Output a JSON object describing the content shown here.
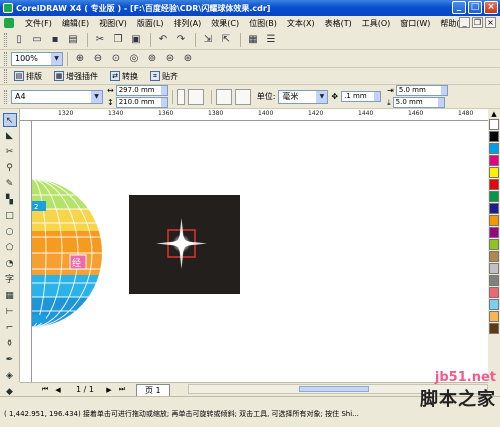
{
  "window": {
    "title": "CorelDRAW X4 ( 专业版 ) - [F:\\百度经验\\CDR\\闪耀球体效果.cdr]",
    "controls": {
      "minimize": "_",
      "maximize": "□",
      "close": "×"
    }
  },
  "menu": [
    "文件(F)",
    "编辑(E)",
    "视图(V)",
    "版面(L)",
    "排列(A)",
    "效果(C)",
    "位图(B)",
    "文本(X)",
    "表格(T)",
    "工具(O)",
    "窗口(W)",
    "帮助(H)"
  ],
  "mdi_controls": {
    "minimize": "_",
    "restore": "❐",
    "close": "×"
  },
  "toolbar2": {
    "zoom_value": "100%"
  },
  "toolbar3": {
    "items": [
      "排版",
      "增强插件",
      "转换",
      "贴齐"
    ]
  },
  "property_bar": {
    "paper": "A4",
    "width": "297.0 mm",
    "height": "210.0 mm",
    "unit_label": "单位:",
    "unit_value": "毫米",
    "nudge": ".1 mm",
    "dup_x": "5.0 mm",
    "dup_y": "5.0 mm"
  },
  "ruler": {
    "labels": [
      "1320",
      "1340",
      "1360",
      "1380",
      "1400",
      "1420",
      "1440",
      "1460",
      "1480"
    ]
  },
  "canvas": {
    "label_badges": [
      "2",
      "经"
    ]
  },
  "palette_colors": [
    "#ffffff",
    "#000000",
    "#00a0e9",
    "#e4007f",
    "#fff100",
    "#e60012",
    "#009944",
    "#1d2088",
    "#f39800",
    "#920783",
    "#8fc31f",
    "#b28850",
    "#c0c0c0",
    "#808080",
    "#eb6877",
    "#7ecef4",
    "#f8b551",
    "#603813"
  ],
  "page_nav": {
    "first": "⏮",
    "prev": "◀",
    "count": "1 / 1",
    "next": "▶",
    "last": "⏭",
    "tab": "页 1"
  },
  "status": {
    "text": "( 1,442.951, 196.434) 接着单击可进行拖动或缩放; 再单击可旋转或倾斜; 双击工具, 可选择所有对象; 按住 Shi..."
  },
  "watermark": {
    "url": "jb51.net",
    "name": "脚本之家"
  }
}
